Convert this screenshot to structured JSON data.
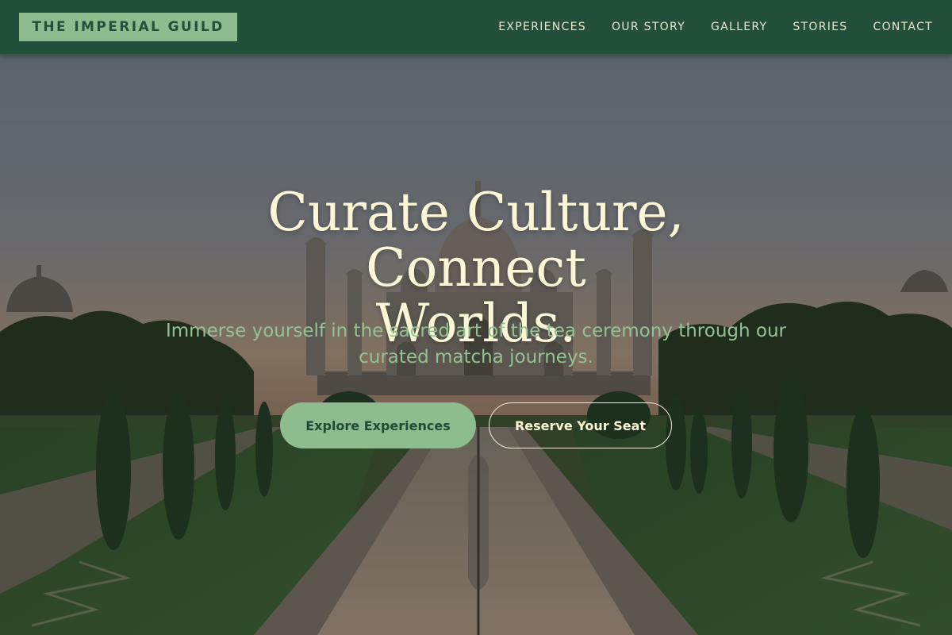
{
  "header": {
    "brand": "THE IMPERIAL GUILD",
    "nav": [
      {
        "label": "EXPERIENCES"
      },
      {
        "label": "OUR STORY"
      },
      {
        "label": "GALLERY"
      },
      {
        "label": "STORIES"
      },
      {
        "label": "CONTACT"
      }
    ]
  },
  "hero": {
    "title_line1": "Curate Culture, Connect",
    "title_line2": "Worlds.",
    "subtitle_line1": "Immerse yourself in the sacred art of the tea ceremony through our",
    "subtitle_line2": "curated matcha journeys.",
    "primary_cta": "Explore Experiences",
    "secondary_cta": "Reserve Your Seat",
    "background": "taj-mahal-sunset-photo"
  },
  "colors": {
    "header_bg": "#22503a",
    "brand_bg": "#8fbc8f",
    "accent_green": "#8fbc8f",
    "title_cream": "#fbf6d6",
    "subtitle_green": "#93c293"
  }
}
